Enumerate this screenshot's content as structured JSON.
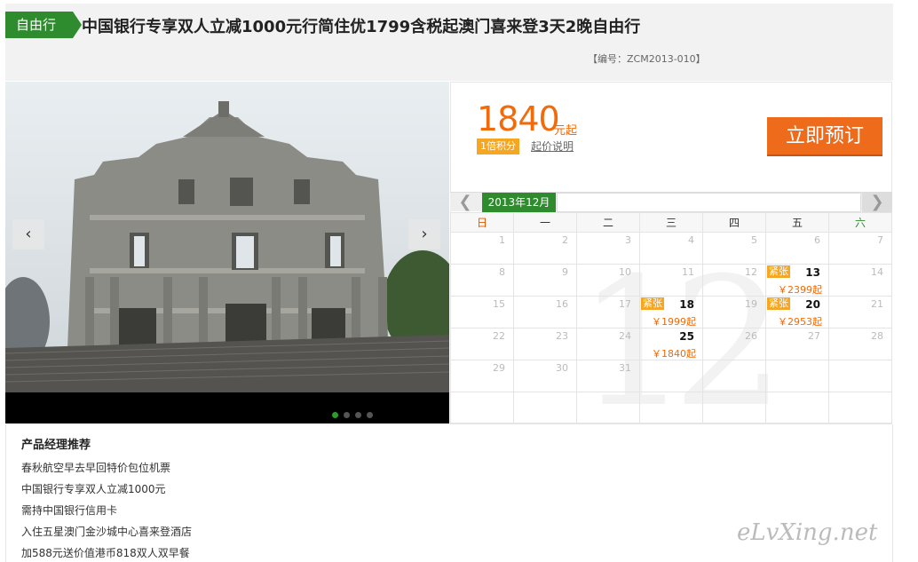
{
  "header": {
    "tag": "自由行",
    "title": "中国银行专享双人立减1000元行简住优1799含税起澳门喜来登3天2晚自由行",
    "code": "【编号：ZCM2013-010】"
  },
  "gallery": {
    "prev_icon": "chevron-left-icon",
    "next_icon": "chevron-right-icon",
    "slide_count": 4,
    "active_slide": 1
  },
  "booking": {
    "price": "1840",
    "price_unit": "元起",
    "points": "1倍积分",
    "price_note": "起价说明",
    "book_label": "立即预订"
  },
  "calendar": {
    "month": "2013年12月",
    "prev": "❮",
    "next": "❯",
    "weekdays": [
      "日",
      "一",
      "二",
      "三",
      "四",
      "五",
      "六"
    ],
    "weeks": [
      [
        {
          "d": "1"
        },
        {
          "d": "2"
        },
        {
          "d": "3"
        },
        {
          "d": "4"
        },
        {
          "d": "5"
        },
        {
          "d": "6"
        },
        {
          "d": "7"
        }
      ],
      [
        {
          "d": "8"
        },
        {
          "d": "9"
        },
        {
          "d": "10"
        },
        {
          "d": "11"
        },
        {
          "d": "12"
        },
        {
          "d": "13",
          "hot": "紧张",
          "price": "￥2399起"
        },
        {
          "d": "14"
        }
      ],
      [
        {
          "d": "15"
        },
        {
          "d": "16"
        },
        {
          "d": "17"
        },
        {
          "d": "18",
          "hot": "紧张",
          "price": "￥1999起"
        },
        {
          "d": "19"
        },
        {
          "d": "20",
          "hot": "紧张",
          "price": "￥2953起"
        },
        {
          "d": "21"
        }
      ],
      [
        {
          "d": "22"
        },
        {
          "d": "23"
        },
        {
          "d": "24"
        },
        {
          "d": "25",
          "price": "￥1840起"
        },
        {
          "d": "26"
        },
        {
          "d": "27"
        },
        {
          "d": "28"
        }
      ],
      [
        {
          "d": "29"
        },
        {
          "d": "30"
        },
        {
          "d": "31"
        },
        {
          "d": ""
        },
        {
          "d": ""
        },
        {
          "d": ""
        },
        {
          "d": ""
        }
      ],
      [
        {
          "d": ""
        },
        {
          "d": ""
        },
        {
          "d": ""
        },
        {
          "d": ""
        },
        {
          "d": ""
        },
        {
          "d": ""
        },
        {
          "d": ""
        }
      ]
    ],
    "watermark": "12"
  },
  "recommend": {
    "title": "产品经理推荐",
    "items": [
      "春秋航空早去早回特价包位机票",
      "中国银行专享双人立减1000元",
      "需持中国银行信用卡",
      "入住五星澳门金沙城中心喜来登酒店",
      "加588元送价值港币818双人双早餐"
    ]
  },
  "brand": "eLvXing.net"
}
